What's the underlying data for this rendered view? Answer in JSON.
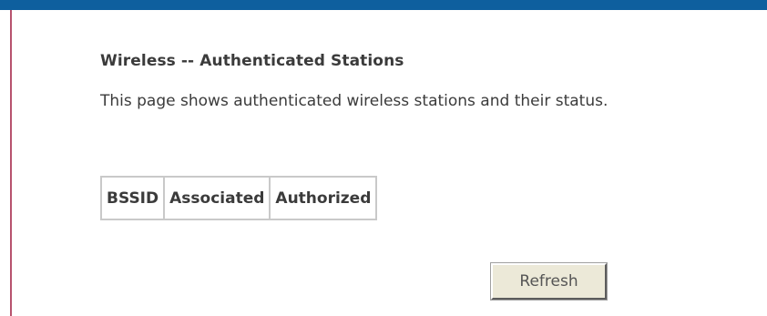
{
  "page": {
    "title": "Wireless -- Authenticated Stations",
    "description": "This page shows authenticated wireless stations and their status."
  },
  "stations_table": {
    "columns": [
      "BSSID",
      "Associated",
      "Authorized"
    ],
    "rows": []
  },
  "actions": {
    "refresh_label": "Refresh"
  },
  "colors": {
    "top_bar": "#0e5f9e",
    "left_border": "#b7536e",
    "text": "#3b3b3b",
    "button_face": "#ece9d8"
  }
}
